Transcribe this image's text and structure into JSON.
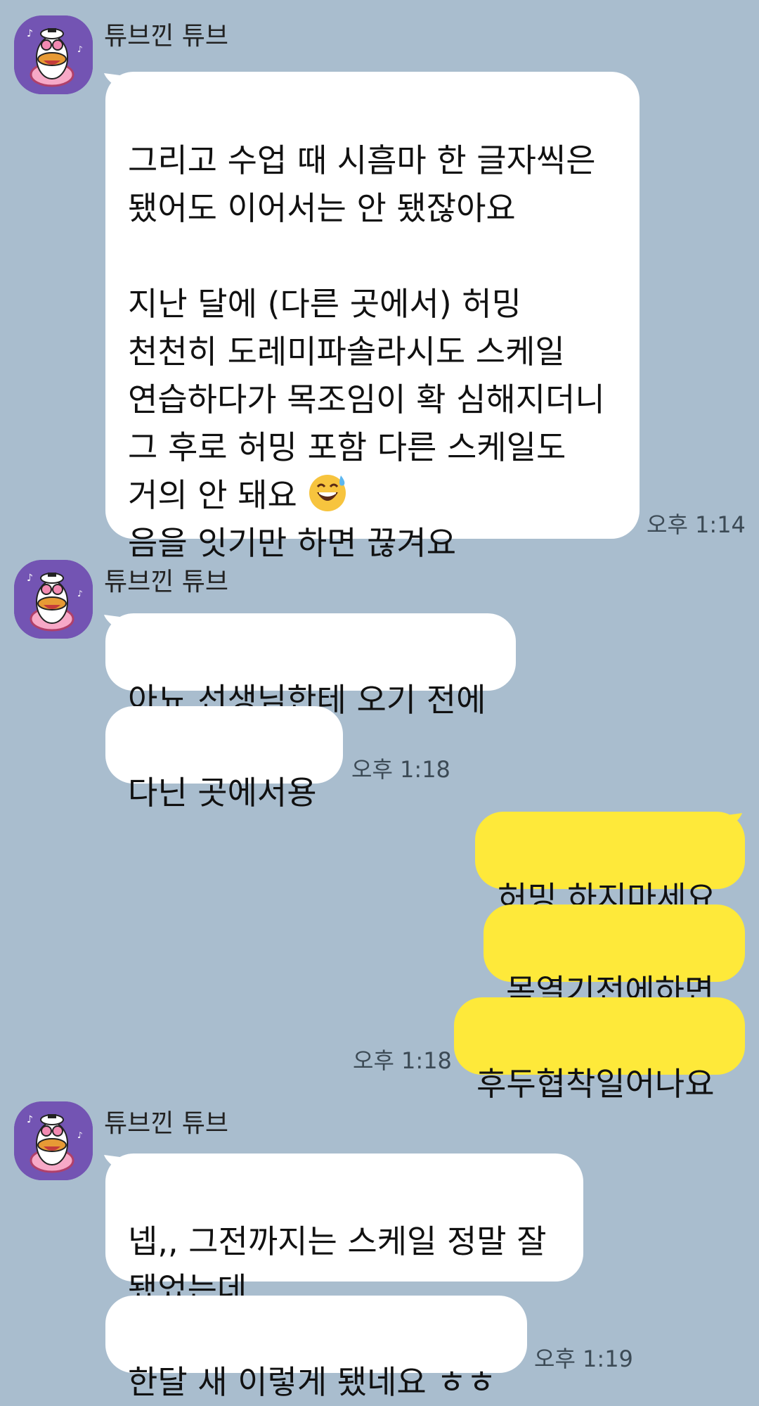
{
  "messages": {
    "group1": {
      "sender": "튜브낀 튜브",
      "bubble1_lines_before_emoji": "그리고 수업 때 시흠마 한 글자씩은\n됐어도 이어서는 안 됐잖아요\n\n지난 달에 (다른 곳에서) 허밍\n천천히 도레미파솔라시도 스케일\n연습하다가 목조임이 확 심해지더니\n그 후로 허밍 포함 다른 스케일도\n거의 안 돼요 ",
      "bubble1_line_after_emoji": "음을 잇기만 하면 끊겨요",
      "emoji": "sweat-smile-emoji",
      "time": "오후 1:14"
    },
    "group2": {
      "sender": "튜브낀 튜브",
      "bubble1": "아뇨 선생님한테 오기 전에",
      "bubble2": "다닌 곳에서용",
      "time": "오후 1:18"
    },
    "group3": {
      "bubble1": "허밍 하지마세요",
      "bubble2": "목열기전에하면",
      "bubble3": "후두협착일어나요",
      "time": "오후 1:18"
    },
    "group4": {
      "sender": "튜브낀 튜브",
      "bubble1": "넵,, 그전까지는 스케일 정말 잘\n됐었는데",
      "bubble2": "한달 새 이렇게 됐네요 ㅎㅎ",
      "time": "오후 1:19"
    }
  },
  "colors": {
    "background": "#a9bdce",
    "incoming_bubble": "#ffffff",
    "outgoing_bubble": "#fee93a",
    "avatar_bg": "#7354b3"
  }
}
